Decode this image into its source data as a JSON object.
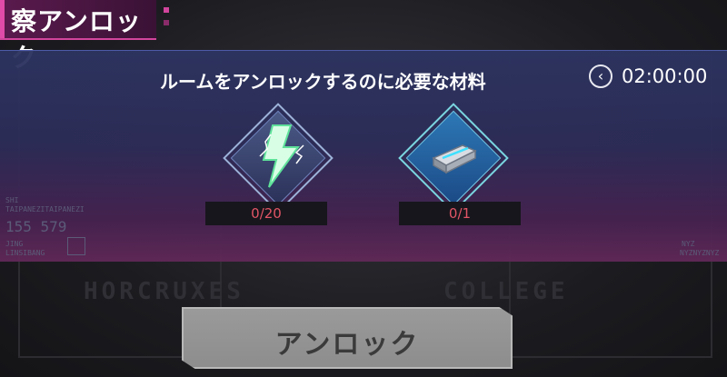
{
  "title": "察アンロック",
  "header": {
    "requirement_text": "ルームをアンロックするのに必要な材料",
    "timer": "02:00:00"
  },
  "materials": [
    {
      "name": "lightning-material",
      "count": "0/20"
    },
    {
      "name": "metal-bar-material",
      "count": "0/1"
    }
  ],
  "background": {
    "left_text": "HORCRUXES",
    "right_text": "COLLEGE",
    "deco_a": "SHI",
    "deco_b": "TAIPANEZITAIPANEZI",
    "deco_c": "155 579",
    "deco_d": "JING",
    "deco_e": "LINSIBANG",
    "deco_f": "NYZ",
    "deco_g": "NYZNYZNYZ"
  },
  "unlock_button": {
    "label": "アンロック"
  },
  "colors": {
    "accent": "#d1459c",
    "count_text": "#e25566"
  }
}
